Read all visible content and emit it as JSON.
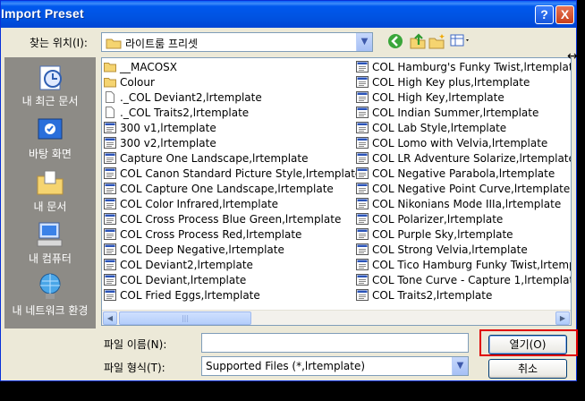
{
  "window": {
    "title": "Import Preset",
    "help_label": "?",
    "close_label": "X"
  },
  "look_in": {
    "label": "찾는 위치(I):",
    "value": "라이트룸 프리셋"
  },
  "toolbar": {
    "back": "back",
    "up": "up-folder",
    "new_folder": "new-folder",
    "views": "views-menu"
  },
  "places": [
    {
      "label": "내 최근 문서",
      "icon": "recent-documents-icon"
    },
    {
      "label": "바탕 화면",
      "icon": "desktop-icon"
    },
    {
      "label": "내 문서",
      "icon": "my-documents-icon"
    },
    {
      "label": "내 컴퓨터",
      "icon": "my-computer-icon"
    },
    {
      "label": "내 네트워크 환경",
      "icon": "network-places-icon"
    }
  ],
  "files_col1": [
    {
      "name": "__MACOSX",
      "type": "folder"
    },
    {
      "name": "Colour",
      "type": "folder"
    },
    {
      "name": "._COL Deviant2,lrtemplate",
      "type": "doc"
    },
    {
      "name": "._COL Traits2,lrtemplate",
      "type": "doc"
    },
    {
      "name": "300 v1,lrtemplate",
      "type": "preset"
    },
    {
      "name": "300 v2,lrtemplate",
      "type": "preset"
    },
    {
      "name": "Capture One Landscape,lrtemplate",
      "type": "preset"
    },
    {
      "name": "COL Canon Standard Picture Style,lrtemplate",
      "type": "preset"
    },
    {
      "name": "COL Capture One Landscape,lrtemplate",
      "type": "preset"
    },
    {
      "name": "COL Color Infrared,lrtemplate",
      "type": "preset"
    },
    {
      "name": "COL Cross Process Blue Green,lrtemplate",
      "type": "preset"
    },
    {
      "name": "COL Cross Process Red,lrtemplate",
      "type": "preset"
    },
    {
      "name": "COL Deep Negative,lrtemplate",
      "type": "preset"
    },
    {
      "name": "COL Deviant2,lrtemplate",
      "type": "preset"
    },
    {
      "name": "COL Deviant,lrtemplate",
      "type": "preset"
    },
    {
      "name": "COL Fried Eggs,lrtemplate",
      "type": "preset"
    }
  ],
  "files_col2": [
    {
      "name": "COL Hamburg's Funky Twist,lrtemplate",
      "type": "preset"
    },
    {
      "name": "COL High Key plus,lrtemplate",
      "type": "preset"
    },
    {
      "name": "COL High Key,lrtemplate",
      "type": "preset"
    },
    {
      "name": "COL Indian Summer,lrtemplate",
      "type": "preset"
    },
    {
      "name": "COL Lab Style,lrtemplate",
      "type": "preset"
    },
    {
      "name": "COL Lomo with Velvia,lrtemplate",
      "type": "preset"
    },
    {
      "name": "COL LR Adventure Solarize,lrtemplate",
      "type": "preset"
    },
    {
      "name": "COL Negative Parabola,lrtemplate",
      "type": "preset"
    },
    {
      "name": "COL Negative Point Curve,lrtemplate",
      "type": "preset"
    },
    {
      "name": "COL Nikonians Mode IIIa,lrtemplate",
      "type": "preset"
    },
    {
      "name": "COL Polarizer,lrtemplate",
      "type": "preset"
    },
    {
      "name": "COL Purple Sky,lrtemplate",
      "type": "preset"
    },
    {
      "name": "COL Strong Velvia,lrtemplate",
      "type": "preset"
    },
    {
      "name": "COL Tico Hamburg Funky Twist,lrtemp",
      "type": "preset"
    },
    {
      "name": "COL Tone Curve - Capture 1,lrtemplate",
      "type": "preset"
    },
    {
      "name": "COL Traits2,lrtemplate",
      "type": "preset"
    }
  ],
  "file_name": {
    "label": "파일 이름(N):",
    "value": ""
  },
  "file_type": {
    "label": "파일 형식(T):",
    "value": "Supported Files (*,lrtemplate)"
  },
  "buttons": {
    "open": "열기(O)",
    "cancel": "취소"
  },
  "colors": {
    "title_bar": "#0054e3",
    "dialog_bg": "#ece9d8",
    "places_bg": "#8d8b86",
    "highlight": "#e00000"
  }
}
